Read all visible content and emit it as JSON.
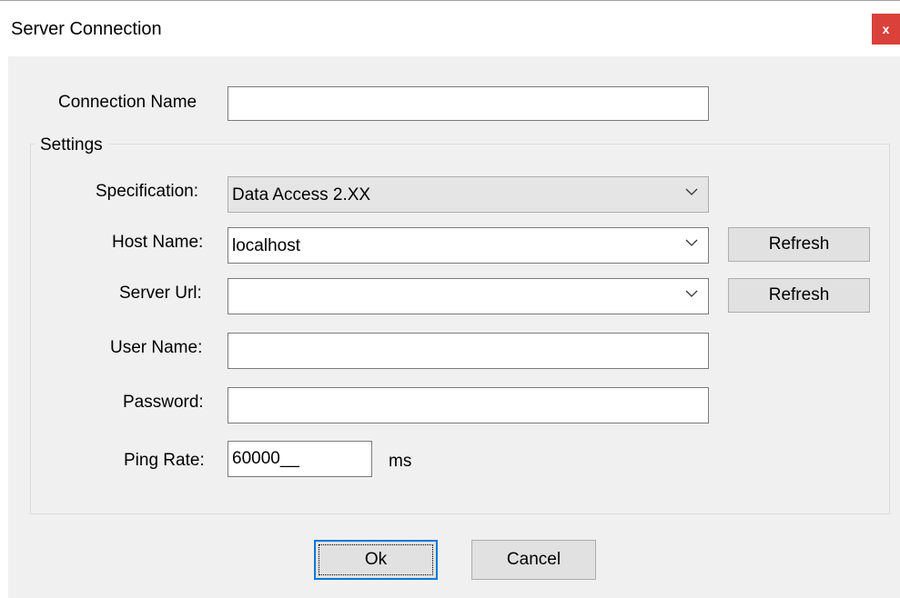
{
  "window": {
    "title": "Server Connection",
    "close_label": "x"
  },
  "form": {
    "connection_name": {
      "label": "Connection Name",
      "value": ""
    },
    "settings_group": "Settings",
    "specification": {
      "label": "Specification:",
      "value": "Data Access 2.XX"
    },
    "host_name": {
      "label": "Host Name:",
      "value": "localhost",
      "refresh_label": "Refresh"
    },
    "server_url": {
      "label": "Server Url:",
      "value": "",
      "refresh_label": "Refresh"
    },
    "user_name": {
      "label": "User Name:",
      "value": ""
    },
    "password": {
      "label": "Password:",
      "value": ""
    },
    "ping_rate": {
      "label": "Ping Rate:",
      "value": "60000__",
      "unit": "ms"
    }
  },
  "buttons": {
    "ok_label": "Ok",
    "cancel_label": "Cancel"
  },
  "icons": {
    "close": "close-icon",
    "dropdown": "chevron-down-icon"
  },
  "colors": {
    "close_button": "#d9413a",
    "default_button_border": "#0078d7",
    "dialog_background": "#f0f0f0"
  }
}
